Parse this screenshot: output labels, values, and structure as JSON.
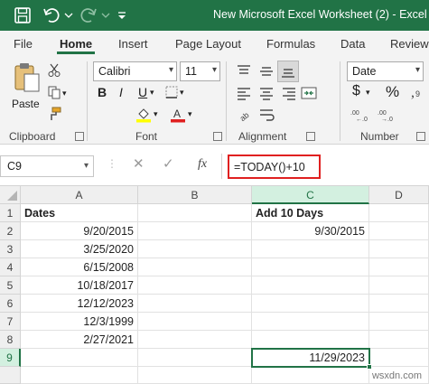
{
  "titlebar": {
    "title": "New Microsoft Excel Worksheet (2)  -  Excel"
  },
  "tabs": [
    "File",
    "Home",
    "Insert",
    "Page Layout",
    "Formulas",
    "Data",
    "Review"
  ],
  "ribbon": {
    "clipboard": {
      "paste_label": "Paste",
      "group_label": "Clipboard"
    },
    "font": {
      "font_name": "Calibri",
      "font_size": "11",
      "group_label": "Font",
      "bold": "B",
      "italic": "I",
      "underline": "U"
    },
    "alignment": {
      "group_label": "Alignment"
    },
    "number": {
      "format": "Date",
      "group_label": "Number",
      "currency": "$",
      "percent": "%"
    }
  },
  "formula_bar": {
    "name_box": "C9",
    "fx": "fx",
    "formula": "=TODAY()+10"
  },
  "sheet": {
    "columns": [
      "A",
      "B",
      "C",
      "D"
    ],
    "rows": [
      "1",
      "2",
      "3",
      "4",
      "5",
      "6",
      "7",
      "8",
      "9"
    ],
    "a": [
      "Dates",
      "9/20/2015",
      "3/25/2020",
      "6/15/2008",
      "10/18/2017",
      "12/12/2023",
      "12/3/1999",
      "2/27/2021",
      ""
    ],
    "c": [
      "Add 10 Days",
      "9/30/2015",
      "",
      "",
      "",
      "",
      "",
      "",
      "11/29/2023"
    ]
  },
  "watermark": "wsxdn.com",
  "colors": {
    "accent": "#217346",
    "highlight": "#e02020"
  }
}
